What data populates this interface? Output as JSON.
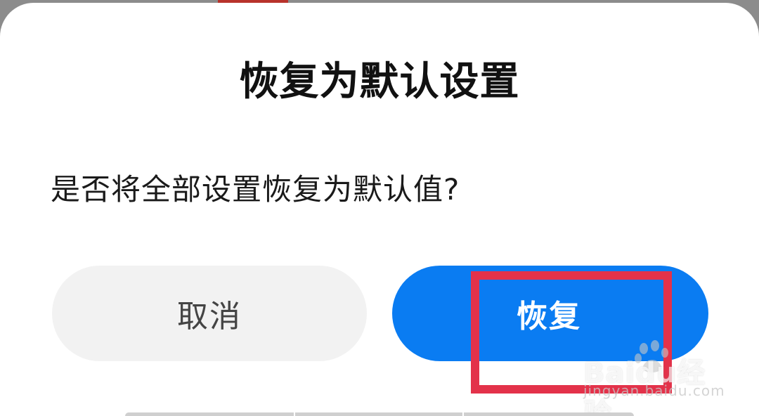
{
  "dialog": {
    "title": "恢复为默认设置",
    "message": "是否将全部设置恢复为默认值?",
    "cancel_label": "取消",
    "confirm_label": "恢复"
  },
  "watermark": {
    "logo_text": "Baidu经验",
    "url": "jingyan.baidu.com"
  },
  "colors": {
    "primary": "#0a7cf2",
    "cancel_bg": "#f2f2f2",
    "highlight": "#e3324a"
  }
}
